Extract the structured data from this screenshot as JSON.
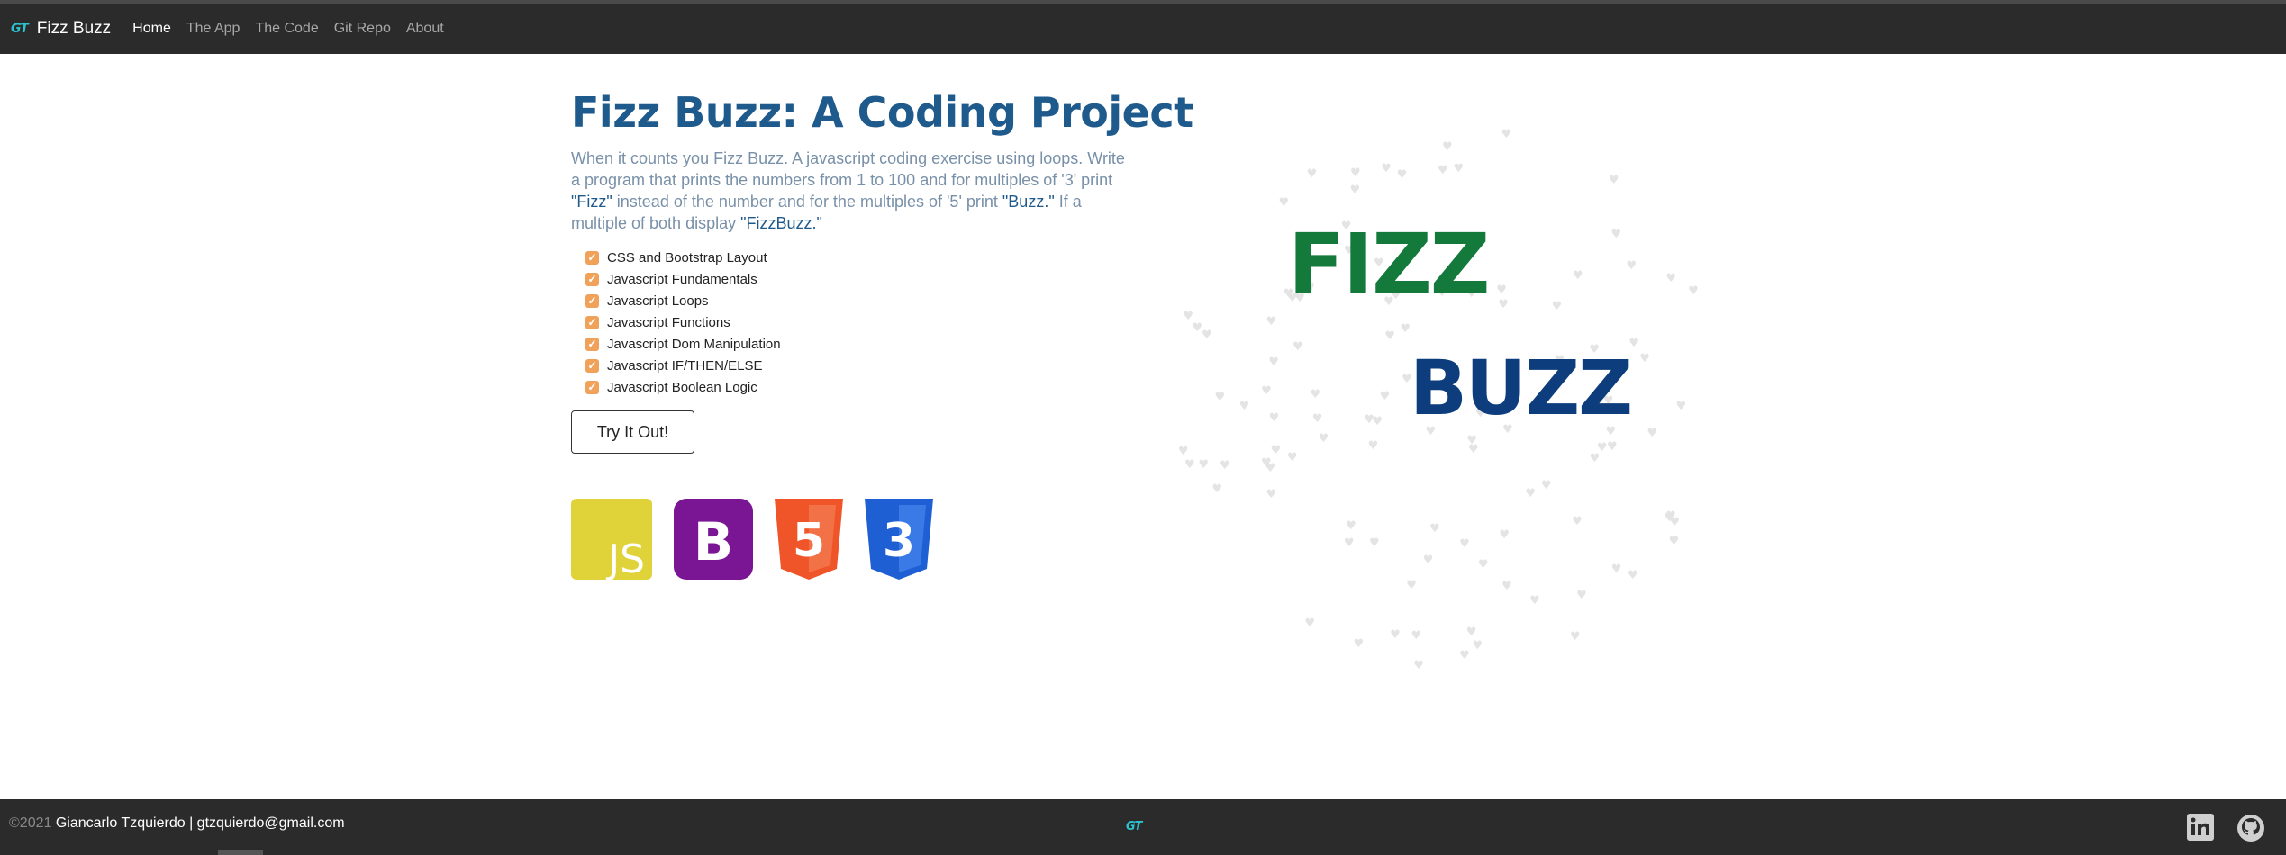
{
  "navbar": {
    "brand_logo": "GT",
    "brand_name": "Fizz Buzz",
    "links": [
      {
        "label": "Home",
        "active": true
      },
      {
        "label": "The App",
        "active": false
      },
      {
        "label": "The Code",
        "active": false
      },
      {
        "label": "Git Repo",
        "active": false
      },
      {
        "label": "About",
        "active": false
      }
    ]
  },
  "hero": {
    "title": "Fizz Buzz: A Coding Project",
    "desc_1": "When it counts you Fizz Buzz. A javascript coding exercise using loops. Write a program that prints the numbers from 1 to 100 and for multiples of '3' print ",
    "desc_fizz": "\"Fizz\"",
    "desc_2": " instead of the number and for the multiples of '5' print ",
    "desc_buzz": "\"Buzz.\"",
    "desc_3": " If a multiple of both display ",
    "desc_fizzbuzz": "\"FizzBuzz.\"",
    "skills": [
      "CSS and Bootstrap Layout",
      "Javascript Fundamentals",
      "Javascript Loops",
      "Javascript Functions",
      "Javascript Dom Manipulation",
      "Javascript IF/THEN/ELSE",
      "Javascript Boolean Logic"
    ],
    "button_label": "Try It Out!",
    "tech_logos": [
      {
        "name": "javascript-logo",
        "text": "JS",
        "color": "#e0d33a"
      },
      {
        "name": "bootstrap-logo",
        "text": "B",
        "color": "#7a1593"
      },
      {
        "name": "html5-logo",
        "text": "5",
        "color": "#f0552a"
      },
      {
        "name": "css3-logo",
        "text": "3",
        "color": "#1f5fd4"
      }
    ]
  },
  "art": {
    "fizz": "FIZZ",
    "buzz": "BUZZ",
    "fizz_color": "#137a3c",
    "buzz_color": "#0e3d7d"
  },
  "footer": {
    "copyright": "©2021",
    "author": "Giancarlo Tzquierdo | gtzquierdo@gmail.com",
    "logo": "GT",
    "social": [
      "linkedin-icon",
      "github-icon"
    ]
  }
}
